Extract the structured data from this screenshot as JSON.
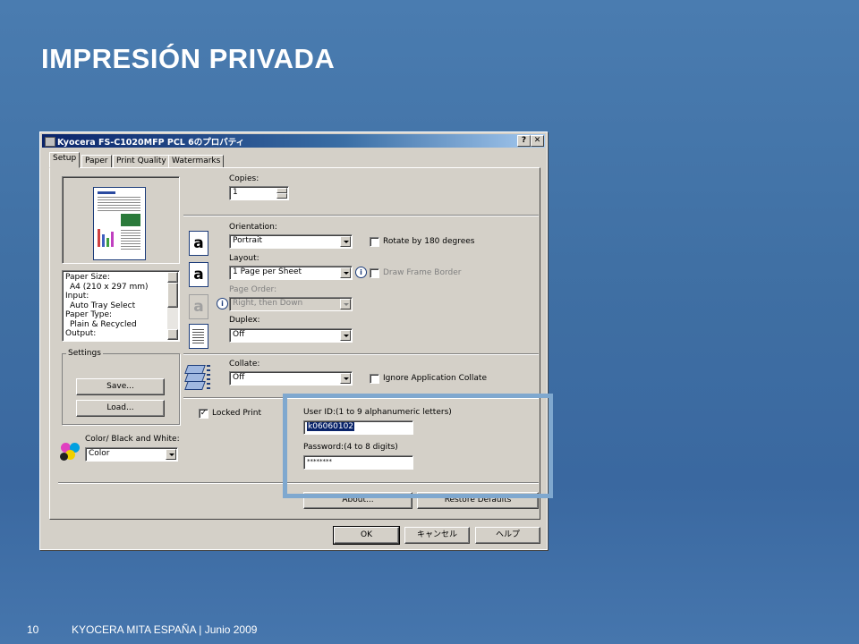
{
  "slide": {
    "title": "IMPRESIÓN PRIVADA",
    "page_number": "10",
    "footer": "KYOCERA MITA ESPAÑA | Junio 2009"
  },
  "dialog": {
    "title": "Kyocera FS-C1020MFP PCL 6のプロパティ",
    "help_btn": "?",
    "close_btn": "✕",
    "tabs": [
      "Setup",
      "Paper",
      "Print Quality",
      "Watermarks"
    ],
    "paper_info_lines": [
      "Paper Size:",
      "  A4 (210 x 297 mm)",
      "Input:",
      "  Auto Tray Select",
      "Paper Type:",
      "  Plain & Recycled",
      "Output:"
    ],
    "settings": {
      "group_label": "Settings",
      "save": "Save...",
      "load": "Load..."
    },
    "copies": {
      "label": "Copies:",
      "value": "1"
    },
    "orientation": {
      "label": "Orientation:",
      "value": "Portrait",
      "rotate_label": "Rotate by 180 degrees"
    },
    "layout": {
      "label": "Layout:",
      "value": "1 Page per Sheet",
      "frame_label": "Draw Frame Border"
    },
    "page_order": {
      "label": "Page Order:",
      "value": "Right, then Down"
    },
    "duplex": {
      "label": "Duplex:",
      "value": "Off"
    },
    "collate": {
      "label": "Collate:",
      "value": "Off",
      "ignore_label": "Ignore Application Collate"
    },
    "locked_print": {
      "label": "Locked Print",
      "checked": "✓"
    },
    "user_id": {
      "label": "User ID:(1 to 9 alphanumeric letters)",
      "value": "k06060102"
    },
    "password": {
      "label": "Password:(4 to 8 digits)",
      "value": "********"
    },
    "color": {
      "label": "Color/ Black and White:",
      "value": "Color"
    },
    "about": "About...",
    "restore": "Restore Defaults",
    "ok": "OK",
    "cancel": "キャンセル",
    "help": "ヘルプ"
  }
}
